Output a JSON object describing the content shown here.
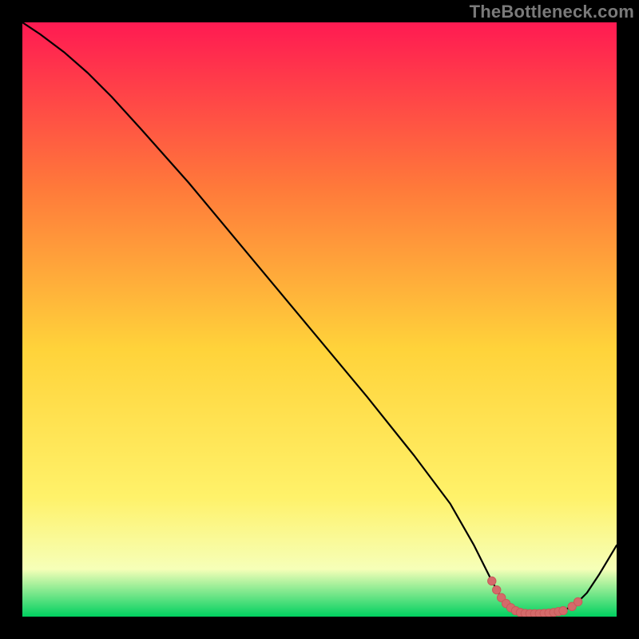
{
  "watermark": "TheBottleneck.com",
  "colors": {
    "background": "#000000",
    "gradient_top": "#ff1a52",
    "gradient_mid_upper": "#ff7a3a",
    "gradient_mid": "#ffd33a",
    "gradient_lower": "#fff26a",
    "gradient_pale": "#f6ffb8",
    "gradient_bottom": "#00d060",
    "curve_stroke": "#000000",
    "marker_fill": "#d46a6a",
    "marker_stroke": "#c85a5a"
  },
  "chart_data": {
    "type": "line",
    "title": "",
    "xlabel": "",
    "ylabel": "",
    "x_range": [
      0,
      100
    ],
    "y_range": [
      0,
      100
    ],
    "curve": [
      {
        "x": 0,
        "y": 100
      },
      {
        "x": 3,
        "y": 98
      },
      {
        "x": 7,
        "y": 95
      },
      {
        "x": 11,
        "y": 91.5
      },
      {
        "x": 15,
        "y": 87.5
      },
      {
        "x": 20,
        "y": 82
      },
      {
        "x": 28,
        "y": 73
      },
      {
        "x": 38,
        "y": 61
      },
      {
        "x": 48,
        "y": 49
      },
      {
        "x": 58,
        "y": 37
      },
      {
        "x": 66,
        "y": 27
      },
      {
        "x": 72,
        "y": 19
      },
      {
        "x": 76,
        "y": 12
      },
      {
        "x": 79,
        "y": 6
      },
      {
        "x": 81,
        "y": 2.5
      },
      {
        "x": 83,
        "y": 1
      },
      {
        "x": 85,
        "y": 0.5
      },
      {
        "x": 87,
        "y": 0.5
      },
      {
        "x": 89,
        "y": 0.6
      },
      {
        "x": 91,
        "y": 1
      },
      {
        "x": 93,
        "y": 2
      },
      {
        "x": 95,
        "y": 4
      },
      {
        "x": 97,
        "y": 7
      },
      {
        "x": 100,
        "y": 12
      }
    ],
    "markers": [
      {
        "x": 79.0,
        "y": 6.0
      },
      {
        "x": 79.8,
        "y": 4.5
      },
      {
        "x": 80.6,
        "y": 3.2
      },
      {
        "x": 81.4,
        "y": 2.2
      },
      {
        "x": 82.2,
        "y": 1.5
      },
      {
        "x": 83.0,
        "y": 1.0
      },
      {
        "x": 83.8,
        "y": 0.7
      },
      {
        "x": 84.6,
        "y": 0.55
      },
      {
        "x": 85.4,
        "y": 0.5
      },
      {
        "x": 86.2,
        "y": 0.5
      },
      {
        "x": 87.0,
        "y": 0.5
      },
      {
        "x": 87.8,
        "y": 0.55
      },
      {
        "x": 88.6,
        "y": 0.6
      },
      {
        "x": 89.4,
        "y": 0.7
      },
      {
        "x": 90.2,
        "y": 0.85
      },
      {
        "x": 91.0,
        "y": 1.0
      },
      {
        "x": 92.5,
        "y": 1.7
      },
      {
        "x": 93.5,
        "y": 2.5
      }
    ],
    "gradient_stops": [
      {
        "offset": 0.0,
        "key": "gradient_top"
      },
      {
        "offset": 0.28,
        "key": "gradient_mid_upper"
      },
      {
        "offset": 0.55,
        "key": "gradient_mid"
      },
      {
        "offset": 0.8,
        "key": "gradient_lower"
      },
      {
        "offset": 0.92,
        "key": "gradient_pale"
      },
      {
        "offset": 1.0,
        "key": "gradient_bottom"
      }
    ]
  }
}
